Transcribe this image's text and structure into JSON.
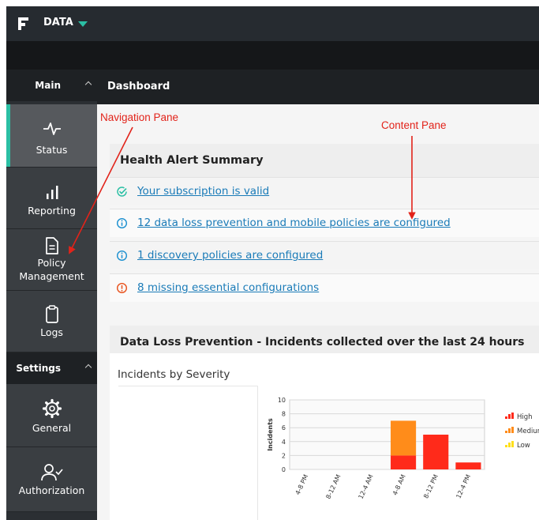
{
  "app": {
    "title": "DATA"
  },
  "sidebar": {
    "main_header": "Main",
    "settings_header": "Settings",
    "main_items": [
      {
        "label": "Status",
        "icon": "activity-icon",
        "active": true
      },
      {
        "label": "Reporting",
        "icon": "bar-chart-icon"
      },
      {
        "label_lines": [
          "Policy",
          "Management"
        ],
        "icon": "document-icon"
      },
      {
        "label": "Logs",
        "icon": "clipboard-icon"
      }
    ],
    "settings_items": [
      {
        "label": "General",
        "icon": "gear-icon"
      },
      {
        "label": "Authorization",
        "icon": "user-check-icon"
      }
    ]
  },
  "content": {
    "header": "Dashboard",
    "health": {
      "title": "Health Alert Summary",
      "alerts": [
        {
          "text": "Your subscription is valid",
          "type": "success"
        },
        {
          "text": "12 data loss prevention and mobile policies are configured",
          "type": "info"
        },
        {
          "text": "1 discovery policies are configured",
          "type": "info"
        },
        {
          "text": "8 missing essential configurations",
          "type": "warning"
        }
      ]
    },
    "dlp": {
      "title": "Data Loss Prevention - Incidents collected over the last 24 hours",
      "subtitle": "Incidents by Severity"
    }
  },
  "annotations": {
    "navigation_pane": "Navigation Pane",
    "content_pane": "Content Pane"
  },
  "colors": {
    "accent": "#2bbfa4",
    "high": "#ff2a1a",
    "medium": "#ff8c1a",
    "low": "#ffe01a",
    "link": "#1a7bb8"
  },
  "chart_data": {
    "type": "bar",
    "stacked": true,
    "ylabel": "Incidents",
    "ylim": [
      0,
      10
    ],
    "yticks": [
      0,
      2,
      4,
      6,
      8,
      10
    ],
    "categories": [
      "4-8 PM",
      "8-12 AM",
      "12-4 AM",
      "4-8 AM",
      "8-12 PM",
      "12-4 PM"
    ],
    "series": [
      {
        "name": "High",
        "values": [
          0,
          0,
          0,
          2,
          5,
          1
        ],
        "color": "#ff2a1a"
      },
      {
        "name": "Medium",
        "values": [
          0,
          0,
          0,
          5,
          0,
          0
        ],
        "color": "#ff8c1a"
      },
      {
        "name": "Low",
        "values": [
          0,
          0,
          0,
          0,
          0,
          0
        ],
        "color": "#ffe01a"
      }
    ],
    "legend_position": "right"
  }
}
